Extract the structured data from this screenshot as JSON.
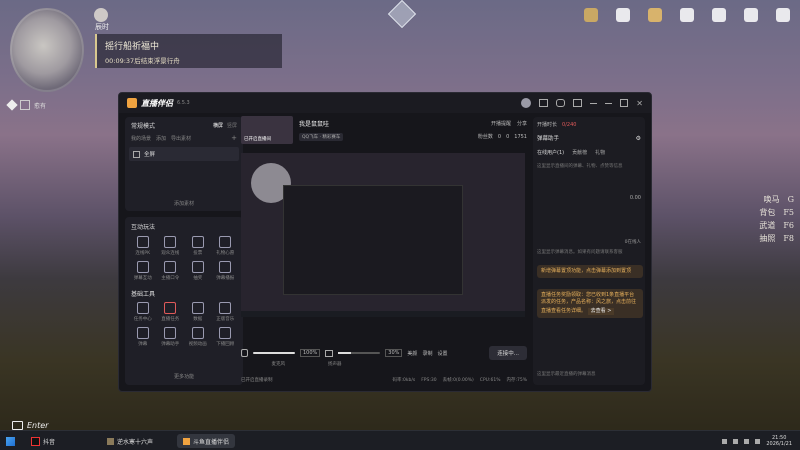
{
  "hud": {
    "map_time_label": "辰时",
    "quest_title": "摇行船祈福中",
    "quest_timer": "00:09:37后结束浮景行舟",
    "location_label": "愈有",
    "chat_hint": "Enter",
    "key_hints": [
      {
        "label": "唤马",
        "key": "G"
      },
      {
        "label": "背包",
        "key": "F5"
      },
      {
        "label": "武道",
        "key": "F6"
      },
      {
        "label": "抽照",
        "key": "F8"
      }
    ]
  },
  "app": {
    "title": "直播伴侣",
    "version": "6.5.3",
    "room_name": "我是鼠鼠哇",
    "room_button": "已开启直播间",
    "room_tag": "QQ飞车 · 精彩赛车",
    "header_actions": [
      "开播提醒",
      "分享"
    ],
    "stats": {
      "fans_label": "粉丝数",
      "fans": "0",
      "likes": "0",
      "hearts": "1751"
    },
    "mode_label": "常规模式",
    "mode_tabs": [
      "横屏",
      "竖屏"
    ],
    "scene_tabs": [
      "我的场景",
      "添加",
      "导出素材"
    ],
    "scene_item": "全屏",
    "add_material": "添加素材",
    "interact_title": "互动玩法",
    "interact_items": [
      "连线PK",
      "观众连线",
      "投票",
      "礼物心愿",
      "弹幕互动",
      "主播口令",
      "抽奖",
      "弹幕播报"
    ],
    "tools_title": "基础工具",
    "tools_items": [
      "任务中心",
      "直播任务",
      "数据",
      "正版音乐",
      "弹幕",
      "弹幕助手",
      "视频动画",
      "下播回顾"
    ],
    "more_label": "更多功能",
    "audio": {
      "mic_label": "麦克风",
      "mic_volume": "100%",
      "speaker_label": "扬声器",
      "speaker_volume": "30%"
    },
    "bottom_actions": [
      "美颜",
      "录制",
      "设置"
    ],
    "connect_button": "连接中...",
    "footer_hint": "已开启直播录制",
    "status_bar": [
      "码率:0kb/s",
      "FPS:30",
      "丢帧:0(0.00%)",
      "CPU:61%",
      "内存:75%"
    ],
    "right_header": {
      "title": "开播时长",
      "value": "0/240"
    },
    "danmu_title": "弹幕助手",
    "danmu_tabs": [
      "在线用户(1)",
      "贡献榜",
      "礼物"
    ],
    "danmu_hint": "这里显示直播间的弹幕、礼物、点赞等信息",
    "danmu_count": "0.00",
    "online_count": "0在线人",
    "system_msg": "这里显示弹幕消息。如果有问题请联系客服",
    "notice1": "新增弹幕置顶功能，点击弹幕添加到置顶",
    "notice2": "直播任务奖励领取：您已收到1条直播平台派发的任务，产品名称：风之旅，点击前往直播查看任务详细。",
    "notice2_link": "去查看 >",
    "danmu_footer": "这里显示最近直播的弹幕消息"
  },
  "taskbar": {
    "apps": [
      "抖音",
      "逆水寒十六声",
      "斗鱼直播伴侣"
    ],
    "time": "21:50",
    "date": "2026/1/21"
  }
}
